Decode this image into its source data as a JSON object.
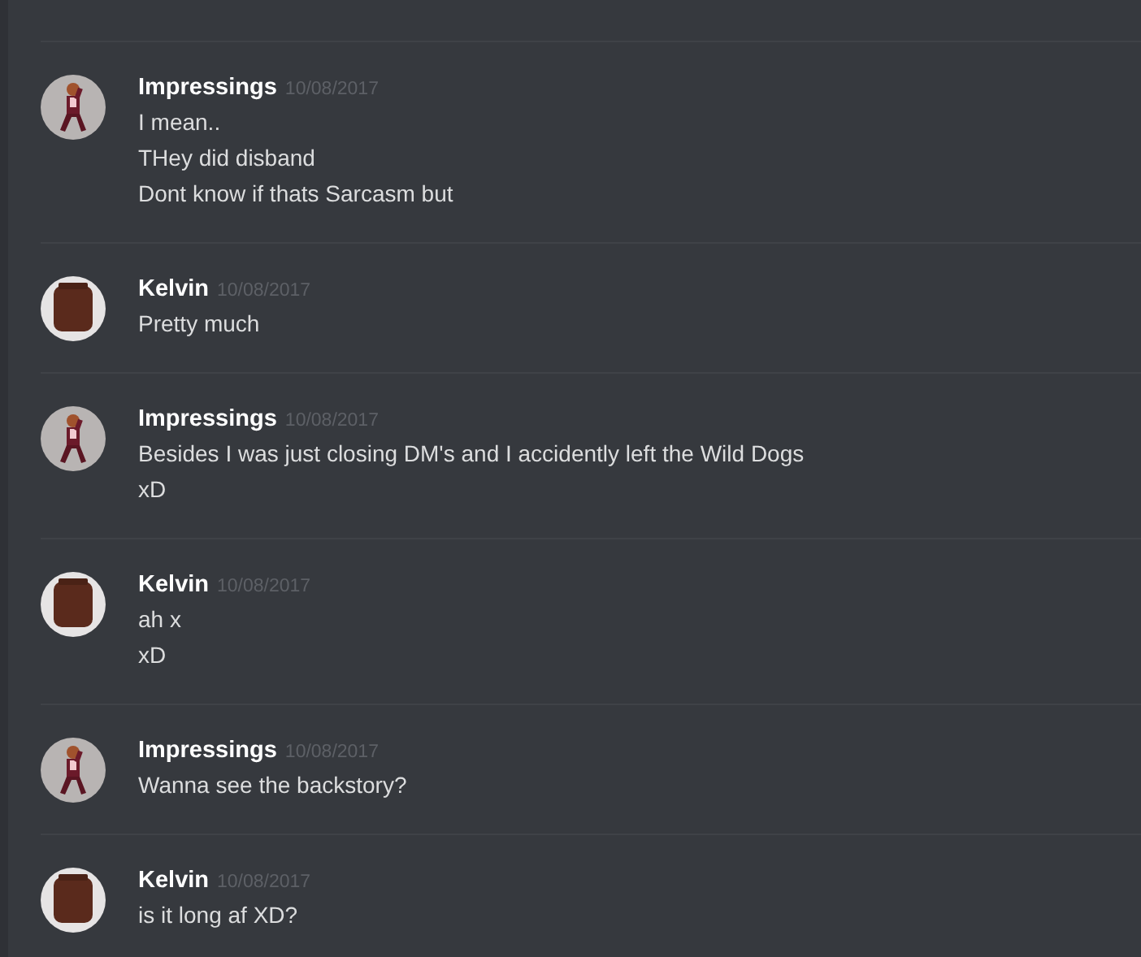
{
  "messages": [
    {
      "author": "Impressings",
      "timestamp": "10/08/2017",
      "kind": "figure",
      "lines": [
        "I mean..",
        "THey did disband",
        "Dont know if thats Sarcasm but"
      ]
    },
    {
      "author": "Kelvin",
      "timestamp": "10/08/2017",
      "kind": "head",
      "lines": [
        "Pretty much"
      ]
    },
    {
      "author": "Impressings",
      "timestamp": "10/08/2017",
      "kind": "figure",
      "lines": [
        "Besides I was just closing DM's and I accidently left the Wild Dogs",
        "xD"
      ]
    },
    {
      "author": "Kelvin",
      "timestamp": "10/08/2017",
      "kind": "head",
      "lines": [
        "ah x",
        "xD"
      ]
    },
    {
      "author": "Impressings",
      "timestamp": "10/08/2017",
      "kind": "figure",
      "lines": [
        "Wanna see the backstory?"
      ]
    },
    {
      "author": "Kelvin",
      "timestamp": "10/08/2017",
      "kind": "head",
      "lines": [
        "is it long af XD?"
      ]
    }
  ]
}
